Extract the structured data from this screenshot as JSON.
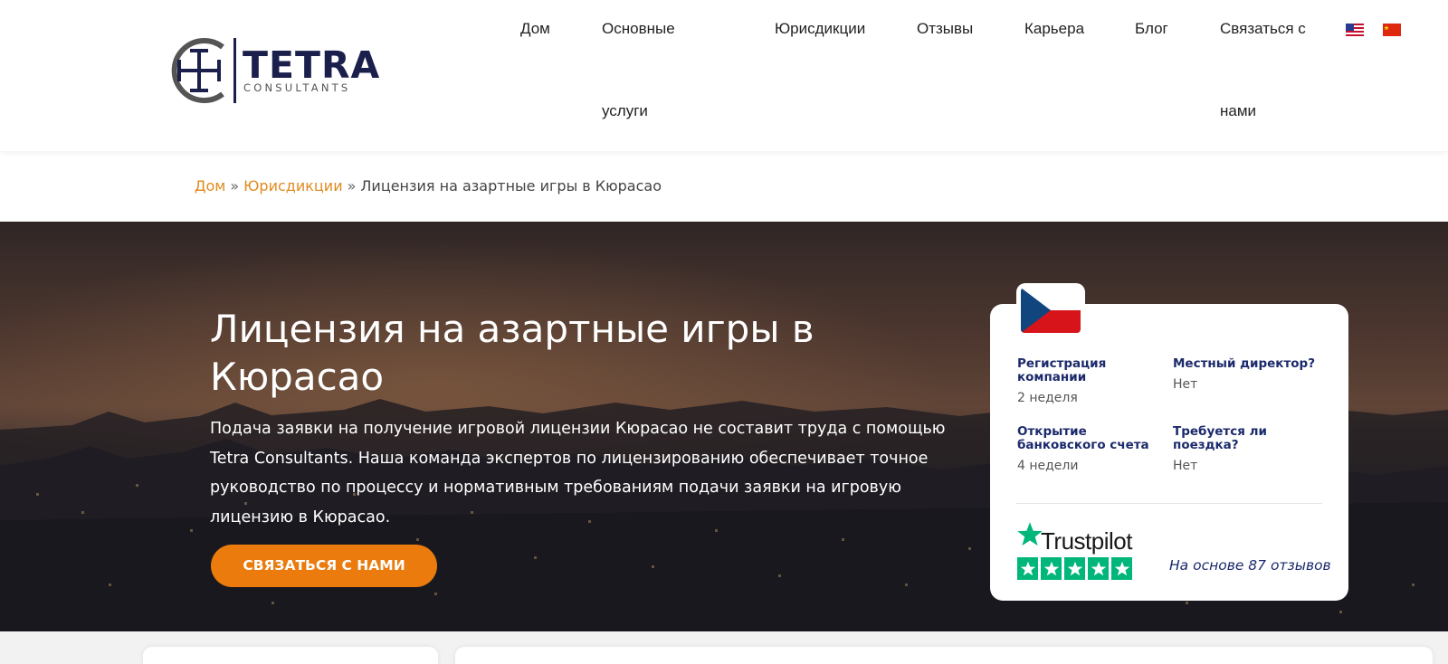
{
  "header": {
    "logo": {
      "word": "TETRA",
      "sub": "CONSULTANTS"
    },
    "nav": [
      {
        "line1": "Дом",
        "line2": ""
      },
      {
        "line1": "Основные",
        "line2": "услуги"
      },
      {
        "line1": "Юрисдикции",
        "line2": ""
      },
      {
        "line1": "Отзывы",
        "line2": ""
      },
      {
        "line1": "Карьера",
        "line2": ""
      },
      {
        "line1": "Блог",
        "line2": ""
      },
      {
        "line1": "Связаться с",
        "line2": "нами"
      }
    ],
    "flags": [
      "us-flag-icon",
      "cn-flag-icon"
    ]
  },
  "breadcrumb": {
    "home": "Дом",
    "sep": "»",
    "jurisdictions": "Юрисдикции",
    "current": "Лицензия на азартные игры в Кюрасао"
  },
  "hero": {
    "title": "Лицензия на азартные игры в Кюрасао",
    "text": "Подача заявки на получение игровой лицензии Кюрасао не составит труда с помощью Tetra Consultants. Наша команда экспертов по лицензированию обеспечивает точное руководство по процессу и нормативным требованиям подачи заявки на игровую лицензию в Кюрасао.",
    "cta": "СВЯЗАТЬСЯ С НАМИ"
  },
  "info_card": {
    "flag": "czech-flag-icon",
    "items": [
      {
        "label": "Регистрация компании",
        "value": "2 неделя"
      },
      {
        "label": "Местный директор?",
        "value": "Нет"
      },
      {
        "label": "Открытие банковского счета",
        "value": "4 недели"
      },
      {
        "label": "Требуется ли поездка?",
        "value": "Нет"
      }
    ],
    "trustpilot": {
      "word": "Trustpilot",
      "rating": 5,
      "reviews_text": "На основе 87 отзывов"
    }
  },
  "colors": {
    "accent": "#ea7b0c",
    "breadcrumb_link": "#e08a1e",
    "navy": "#1b2a6b",
    "trustpilot_green": "#00b67a"
  }
}
